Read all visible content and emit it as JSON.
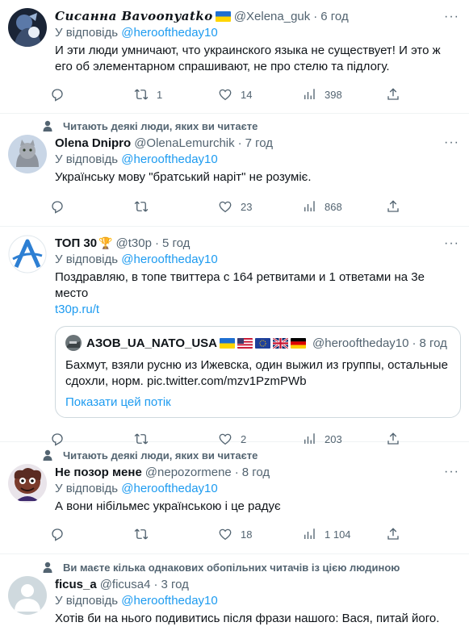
{
  "tweets": [
    {
      "social_context": "",
      "display_name": "𝓢𝓲𝓬𝓪𝓷𝓷𝓪 𝓑𝓪𝓿𝓸𝓸𝓷𝔂𝓪𝓽𝓴𝓸",
      "display_name_plain": "Сисанна Bavoonyatko",
      "handle": "@Xelena_guk",
      "separator": "·",
      "time": "6 год",
      "reply_prefix": "У відповідь",
      "reply_mention": "@herooftheday10",
      "text": "И эти люди умничают, что украинского языка не существует! И это ж его об элементарном спрашивают, не про стелю та підлогу.",
      "replies": "",
      "retweets": "1",
      "likes": "14",
      "views": "398"
    },
    {
      "social_context": "Читають деякі люди, яких ви читаєте",
      "display_name": "Olena Dnipro",
      "handle": "@OlenaLemurchik",
      "separator": "·",
      "time": "7 год",
      "reply_prefix": "У відповідь",
      "reply_mention": "@herooftheday10",
      "text": "Українську мову \"братський наріт\" не розуміє.",
      "replies": "",
      "retweets": "",
      "likes": "23",
      "views": "868"
    },
    {
      "social_context": "",
      "display_name": "ТОП 30",
      "handle": "@t30p",
      "separator": "·",
      "time": "5 год",
      "reply_prefix": "У відповідь",
      "reply_mention": "@herooftheday10",
      "text": "Поздравляю, в топе твиттера с 164 ретвитами и 1 ответами на 3е место",
      "link": "t30p.ru/t",
      "quote": {
        "display_name": "АЗОВ_UA_NATO_USA",
        "handle": "@herooftheday10",
        "separator": "·",
        "time": "8 год",
        "text": "Бахмут, взяли русню из Ижевска, один выжил из группы, остальные сдохли, норм. pic.twitter.com/mzv1PzmPWb",
        "show_thread": "Показати цей потік"
      },
      "replies": "",
      "retweets": "",
      "likes": "2",
      "views": "203"
    },
    {
      "social_context": "Читають деякі люди, яких ви читаєте",
      "display_name": "Не позор мене",
      "handle": "@nepozormene",
      "separator": "·",
      "time": "8 год",
      "reply_prefix": "У відповідь",
      "reply_mention": "@herooftheday10",
      "text": "А вони нібільмес українською і це радує",
      "replies": "",
      "retweets": "",
      "likes": "18",
      "views": "1 104"
    },
    {
      "social_context": "Ви маєте кілька однакових обопільних читачів із цією людиною",
      "display_name": "ficus_a",
      "handle": "@ficusa4",
      "separator": "·",
      "time": "3 год",
      "reply_prefix": "У відповідь",
      "reply_mention": "@herooftheday10",
      "text": "Хотів би на нього подивитись після фрази нашого: Вася, питай його."
    }
  ],
  "icons": {
    "reply": "reply-icon",
    "retweet": "retweet-icon",
    "like": "heart-icon",
    "views": "views-icon",
    "share": "share-icon",
    "more": "more-icon",
    "person": "person-icon"
  },
  "colors": {
    "accent": "#1d9bf0",
    "muted": "#536471",
    "text": "#0f1419",
    "border": "#eff3f4"
  }
}
